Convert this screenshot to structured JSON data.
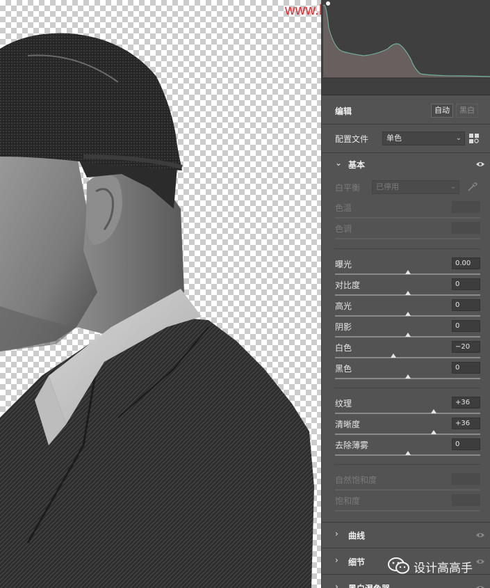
{
  "watermark": "www.baoyidiansheji.com",
  "panel": {
    "edit": {
      "title": "编辑",
      "auto_label": "自动",
      "bw_label": "黑白"
    },
    "profile": {
      "label": "配置文件",
      "value": "单色"
    },
    "basic": {
      "title": "基本",
      "white_balance": {
        "label": "白平衡",
        "value": "已停用"
      },
      "disabled_sliders": [
        {
          "label": "色温"
        },
        {
          "label": "色调"
        }
      ],
      "tone_sliders": [
        {
          "label": "曝光",
          "value": "0.00",
          "position": 0.5
        },
        {
          "label": "对比度",
          "value": "0",
          "position": 0.5
        },
        {
          "label": "高光",
          "value": "0",
          "position": 0.5
        },
        {
          "label": "阴影",
          "value": "0",
          "position": 0.5
        },
        {
          "label": "白色",
          "value": "−20",
          "position": 0.4
        },
        {
          "label": "黑色",
          "value": "0",
          "position": 0.5
        }
      ],
      "presence_sliders": [
        {
          "label": "纹理",
          "value": "+36",
          "position": 0.68
        },
        {
          "label": "清晰度",
          "value": "+36",
          "position": 0.68
        },
        {
          "label": "去除薄雾",
          "value": "0",
          "position": 0.5
        }
      ],
      "saturation_sliders": [
        {
          "label": "自然饱和度"
        },
        {
          "label": "饱和度"
        }
      ]
    },
    "sections": [
      {
        "title": "曲线"
      },
      {
        "title": "细节"
      },
      {
        "title": "黑白混色器"
      }
    ]
  },
  "wechat_badge": "设计高高手",
  "colors": {
    "panel_bg": "#535353",
    "histogram_bg": "#3f3f3f",
    "histogram_line": "#6fae98",
    "watermark": "#e8272c"
  },
  "icons": [
    "eye-icon",
    "eyedropper-icon",
    "grid-icon",
    "chevron-down-icon",
    "chevron-right-icon",
    "wechat-icon"
  ]
}
